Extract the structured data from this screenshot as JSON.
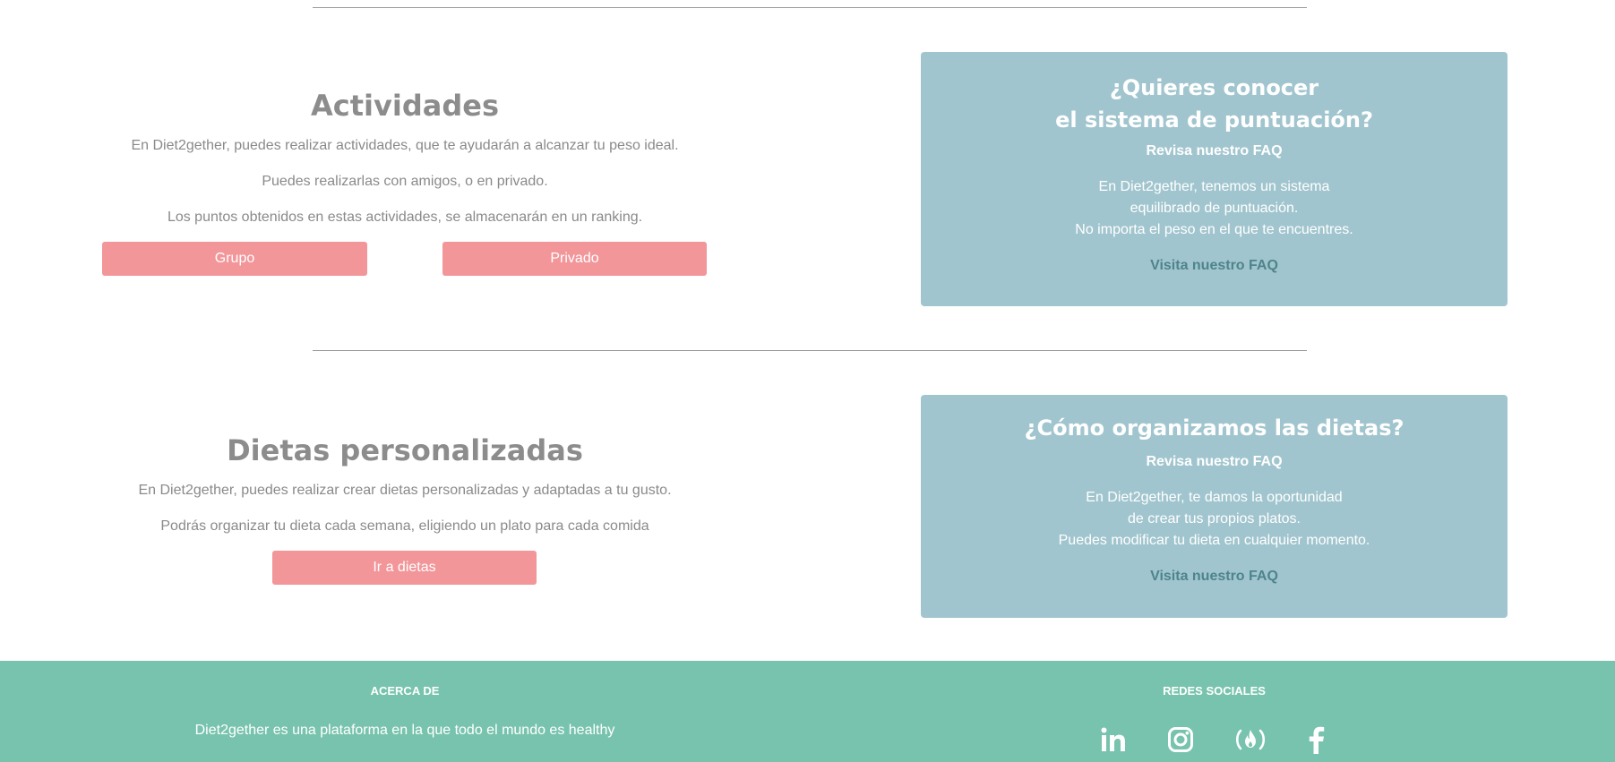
{
  "activities": {
    "title": "Actividades",
    "paragraphs": [
      "En Diet2gether, puedes realizar actividades, que te ayudarán a alcanzar tu peso ideal.",
      "Puedes realizarlas con amigos, o en privado.",
      "Los puntos obtenidos en estas actividades, se almacenarán en un ranking."
    ],
    "group_button": "Grupo",
    "private_button": "Privado"
  },
  "score_card": {
    "title_line1": "¿Quieres conocer",
    "title_line2": "el sistema de puntuación?",
    "subtitle": "Revisa nuestro FAQ",
    "body_lines": [
      "En Diet2gether, tenemos un sistema",
      "equilibrado de puntuación.",
      "No importa el peso en el que te encuentres."
    ],
    "link": "Visita nuestro FAQ"
  },
  "diets": {
    "title": "Dietas personalizadas",
    "paragraphs": [
      "En Diet2gether, puedes realizar crear dietas personalizadas y adaptadas a tu gusto.",
      "Podrás organizar tu dieta cada semana, eligiendo un plato para cada comida"
    ],
    "button": "Ir a dietas"
  },
  "diet_card": {
    "title": "¿Cómo organizamos las dietas?",
    "subtitle": "Revisa nuestro FAQ",
    "body_lines": [
      "En Diet2gether, te damos la oportunidad",
      "de crear tus propios platos.",
      "Puedes modificar tu dieta en cualquier momento."
    ],
    "link": "Visita nuestro FAQ"
  },
  "footer": {
    "about_title": "ACERCA DE",
    "about_text": "Diet2gether es una plataforma en la que todo el mundo es healthy",
    "social_title": "REDES SOCIALES",
    "icons": [
      "linkedin-icon",
      "instagram-icon",
      "freecodecamp-icon",
      "facebook-icon"
    ]
  },
  "colors": {
    "button": "#f2969a",
    "card": "#a1c5ce",
    "card_link": "#4e848c",
    "footer": "#78c3ad"
  }
}
